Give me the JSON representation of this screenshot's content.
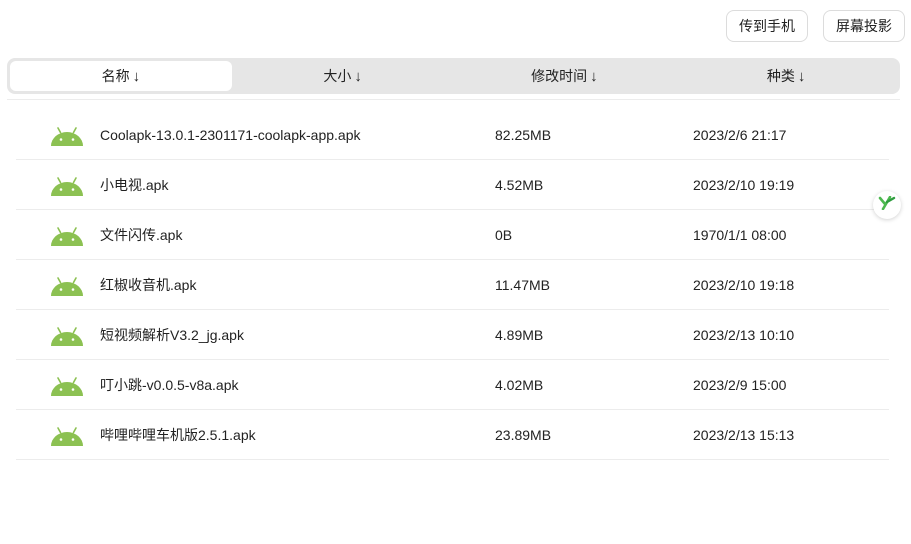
{
  "toolbar": {
    "send_to_phone_label": "传到手机",
    "screen_cast_label": "屏幕投影"
  },
  "sort_tabs": [
    {
      "label": "名称",
      "arrow": "↓",
      "active": true
    },
    {
      "label": "大小",
      "arrow": "↓",
      "active": false
    },
    {
      "label": "修改时间",
      "arrow": "↓",
      "active": false
    },
    {
      "label": "种类",
      "arrow": "↓",
      "active": false
    }
  ],
  "files": [
    {
      "icon": "android-icon",
      "name": "Coolapk-13.0.1-2301171-coolapk-app.apk",
      "size": "82.25MB",
      "date": "2023/2/6 21:17"
    },
    {
      "icon": "android-icon",
      "name": "小电视.apk",
      "size": "4.52MB",
      "date": "2023/2/10 19:19"
    },
    {
      "icon": "android-icon",
      "name": "文件闪传.apk",
      "size": "0B",
      "date": "1970/1/1 08:00"
    },
    {
      "icon": "android-icon",
      "name": "红椒收音机.apk",
      "size": "11.47MB",
      "date": "2023/2/10 19:18"
    },
    {
      "icon": "android-icon",
      "name": "短视频解析V3.2_jg.apk",
      "size": "4.89MB",
      "date": "2023/2/13 10:10"
    },
    {
      "icon": "android-icon",
      "name": "叮小跳-v0.0.5-v8a.apk",
      "size": "4.02MB",
      "date": "2023/2/9 15:00"
    },
    {
      "icon": "android-icon",
      "name": "哔哩哔哩车机版2.5.1.apk",
      "size": "23.89MB",
      "date": "2023/2/13 15:13"
    }
  ],
  "colors": {
    "android_green": "#8cc152",
    "float_icon_green": "#4cb84f"
  },
  "float_button": {
    "icon": "y-logo-icon"
  }
}
